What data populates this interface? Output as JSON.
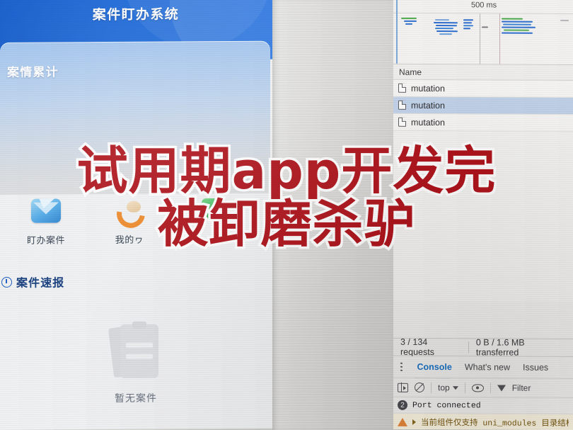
{
  "phone_app": {
    "title": "案件盯办系统",
    "stat_card": {
      "title": "案情累计"
    },
    "shortcuts": [
      {
        "label": "盯办案件",
        "icon": "envelope-icon"
      },
      {
        "label": "我的ヮ",
        "icon": "phone-handset-icon"
      },
      {
        "label": "",
        "icon": "chat-bubble-icon"
      }
    ],
    "section": {
      "icon": "clock-icon",
      "title": "案件速报"
    },
    "empty_state": {
      "icon": "clipboard-icon",
      "text": "暂无案件"
    }
  },
  "devtools": {
    "overview": {
      "time_label": "500 ms"
    },
    "network_table": {
      "column_header": "Name",
      "rows": [
        {
          "name": "mutation",
          "selected": false
        },
        {
          "name": "mutation",
          "selected": true
        },
        {
          "name": "mutation",
          "selected": false
        }
      ]
    },
    "summary": {
      "requests": "3 / 134 requests",
      "transferred": "0 B / 1.6 MB transferred"
    },
    "drawer_tabs": [
      {
        "label": "Console",
        "active": true
      },
      {
        "label": "What's new",
        "active": false
      },
      {
        "label": "Issues",
        "active": false
      }
    ],
    "console_toolbar": {
      "sidebar_icon": "sidebar-toggle-icon",
      "clear_icon": "clear-console-icon",
      "context": "top",
      "eye_icon": "live-expression-icon",
      "filter_icon": "filter-funnel-icon",
      "filter_placeholder": "Filter"
    },
    "console_messages": [
      {
        "type": "info",
        "count": "2",
        "text": "Port connected"
      },
      {
        "type": "warning",
        "text": "当前组件仅支持 uni_modules 目录结构"
      }
    ]
  },
  "caption": {
    "line1": "试用期app开发完",
    "line2": "被卸磨杀驴",
    "color": "#b0141c",
    "stroke_color": "#ffffff"
  },
  "theme": {
    "app_header_blue": "#1464d8",
    "card_blue": "#a9c9ef",
    "devtools_bg": "#f1f0ee",
    "selected_row": "#c2d3ea",
    "active_tab": "#1a73c8",
    "warning_bg": "#fdf6e3"
  }
}
